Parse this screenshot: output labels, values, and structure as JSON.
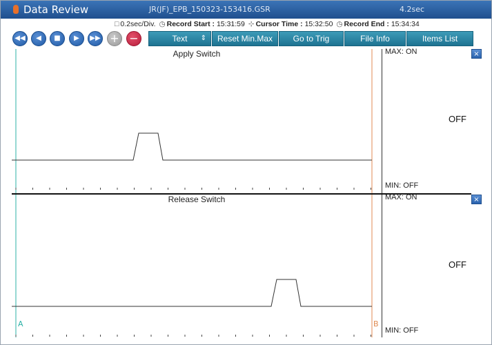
{
  "window": {
    "title": "Data Review",
    "file": "JR(JF)_EPB_150323-153416.GSR",
    "duration": "4.2sec"
  },
  "info": {
    "div": "0.2sec/Div.",
    "record_start_label": "Record Start :",
    "record_start": "15:31:59",
    "cursor_time_label": "Cursor Time :",
    "cursor_time": "15:32:50",
    "record_end_label": "Record End :",
    "record_end": "15:34:34"
  },
  "toolbar": {
    "text": "Text",
    "reset": "Reset Min.Max",
    "trig": "Go to Trig",
    "fileinfo": "File Info",
    "items": "Items List"
  },
  "colors": {
    "titlebar": "#2d63a5",
    "button": "#2a83a2",
    "cursor_a": "#2bb0a6",
    "cursor_b": "#e08a50"
  },
  "panels": [
    {
      "title": "Apply Switch",
      "max": "MAX: ON",
      "min": "MIN: OFF",
      "value": "OFF"
    },
    {
      "title": "Release Switch",
      "max": "MAX: ON",
      "min": "MIN: OFF",
      "value": "OFF"
    }
  ],
  "cursors": {
    "a": "A",
    "b": "B"
  },
  "close_symbol": "×"
}
